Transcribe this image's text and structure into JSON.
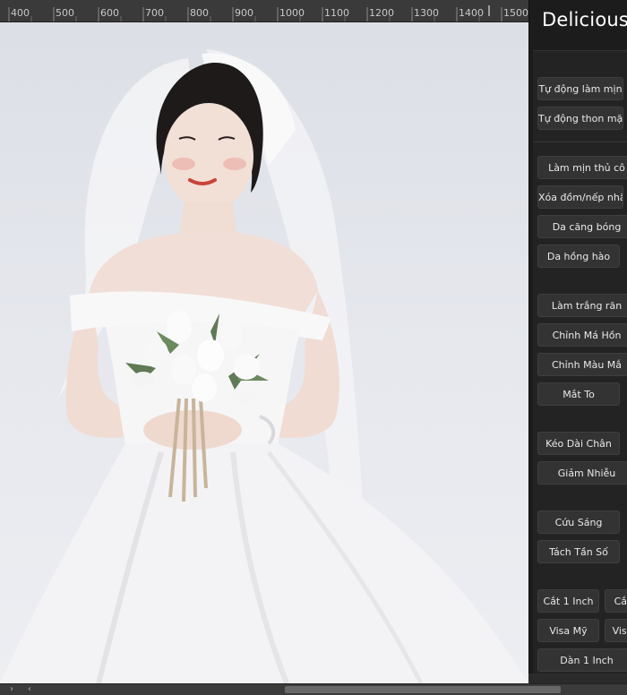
{
  "ruler": {
    "ticks": [
      "400",
      "500",
      "600",
      "700",
      "800",
      "900",
      "1000",
      "1100",
      "1200",
      "1300",
      "1400",
      "1500"
    ]
  },
  "canvas": {
    "image": "bride-photo",
    "description_icon": "bride-with-tulip-bouquet"
  },
  "panel": {
    "title": "Delicious",
    "buttons": {
      "tu_dong_lam_min": "Tự động làm mịn",
      "tu_dong_thon_mat": "Tự động thon mặt",
      "lam_min_thu_cong": "Làm mịn thủ cô",
      "xoa_dom": "Xóa đồm/nếp nhăn",
      "da_cang_bong": "Da căng bóng",
      "da_hong_hao": "Da hồng hào",
      "lam_trang_rang": "Làm trắng răn",
      "chinh_ma_hong": "Chỉnh Má Hồn",
      "chinh_mau_mat": "Chỉnh Màu Mắ",
      "mat_to": "Mắt To",
      "keo_dai_chan": "Kéo Dài Chân",
      "giam_nhieu": "Giảm Nhiễu",
      "cuu_sang": "Cứu Sáng",
      "tach_tan_so": "Tách Tần Số",
      "cat_1_inch": "Cắt 1 Inch",
      "cat_2": "Cắt",
      "visa_my": "Visa Mỹ",
      "visa_2": "Visa",
      "dan_1_inch": "Dàn 1 Inch"
    }
  },
  "scrollbar": {
    "left_arrow": "›",
    "left_arrow2": "‹"
  },
  "colors": {
    "panel_bg": "#1c1c1c",
    "button_bg": "#333333",
    "ruler_bg": "#3a3a3a",
    "canvas_bg": "#e4e6ec"
  }
}
